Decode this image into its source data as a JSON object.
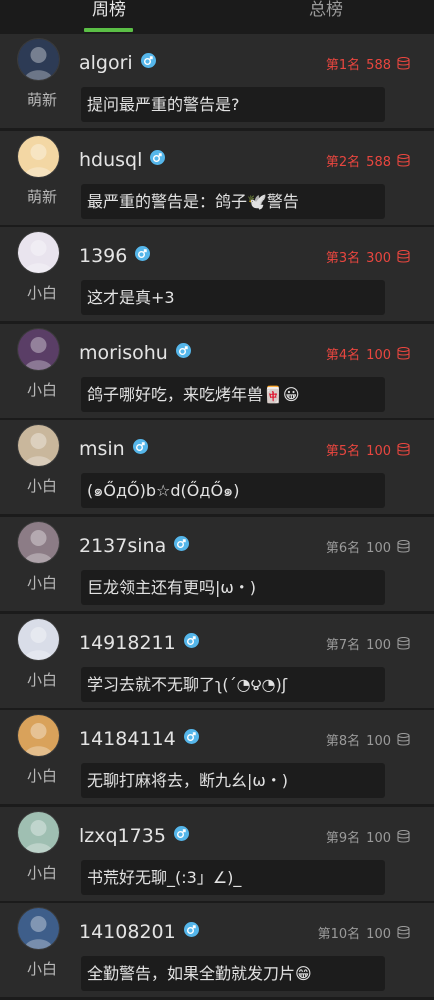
{
  "tabs": {
    "week": "周榜",
    "total": "总榜"
  },
  "colors": {
    "accent": "#5bbf46",
    "top_rank": "#e8463f",
    "gender": "#55b6ea"
  },
  "rows": [
    {
      "name": "algori",
      "level": "萌新",
      "rank": "第1名",
      "points": "588",
      "message": "提问最严重的警告是?",
      "avatar_color": "#2d3b55"
    },
    {
      "name": "hdusql",
      "level": "萌新",
      "rank": "第2名",
      "points": "588",
      "message": "最严重的警告是：鸽子🕊️警告",
      "avatar_color": "#f3d7a4"
    },
    {
      "name": "1396",
      "level": "小白",
      "rank": "第3名",
      "points": "300",
      "message": "这才是真+3",
      "avatar_color": "#e9e4ee"
    },
    {
      "name": "morisohu",
      "level": "小白",
      "rank": "第4名",
      "points": "100",
      "message": "鸽子哪好吃，来吃烤年兽🀄😀",
      "avatar_color": "#5a3e66"
    },
    {
      "name": "msin",
      "level": "小白",
      "rank": "第5名",
      "points": "100",
      "message": "(๑ŐдŐ)b☆d(ŐдŐ๑)",
      "avatar_color": "#c9b79c"
    },
    {
      "name": "2137sina",
      "level": "小白",
      "rank": "第6名",
      "points": "100",
      "message": "巨龙领主还有更吗|ω・)",
      "avatar_color": "#8c7c86"
    },
    {
      "name": "14918211",
      "level": "小白",
      "rank": "第7名",
      "points": "100",
      "message": "学习去就不无聊了ʅ(´◔౪◔)ʃ",
      "avatar_color": "#d9dde8"
    },
    {
      "name": "14184114",
      "level": "小白",
      "rank": "第8名",
      "points": "100",
      "message": "无聊打麻将去，断九幺|ω・)",
      "avatar_color": "#d9a25b"
    },
    {
      "name": "lzxq1735",
      "level": "小白",
      "rank": "第9名",
      "points": "100",
      "message": "书荒好无聊_(:3」∠)_",
      "avatar_color": "#9fbfb2"
    },
    {
      "name": "14108201",
      "level": "小白",
      "rank": "第10名",
      "points": "100",
      "message": "全勤警告，如果全勤就发刀片😁",
      "avatar_color": "#3e5e8a"
    }
  ]
}
